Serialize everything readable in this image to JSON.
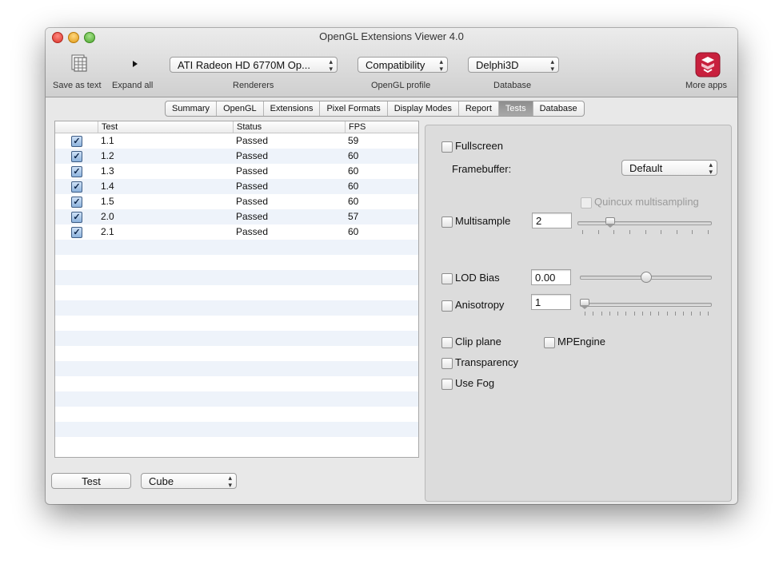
{
  "window": {
    "title": "OpenGL Extensions Viewer 4.0"
  },
  "toolbar": {
    "save_as_text": "Save as text",
    "expand_all": "Expand all",
    "renderer_value": "ATI Radeon HD 6770M Op...",
    "renderers_label": "Renderers",
    "profile_value": "Compatibility",
    "profile_label": "OpenGL profile",
    "database_value": "Delphi3D",
    "database_label": "Database",
    "more_apps": "More apps"
  },
  "tabs": [
    {
      "label": "Summary",
      "active": false
    },
    {
      "label": "OpenGL",
      "active": false
    },
    {
      "label": "Extensions",
      "active": false
    },
    {
      "label": "Pixel Formats",
      "active": false
    },
    {
      "label": "Display Modes",
      "active": false
    },
    {
      "label": "Report",
      "active": false
    },
    {
      "label": "Tests",
      "active": true
    },
    {
      "label": "Database",
      "active": false
    }
  ],
  "table": {
    "columns": [
      "Test",
      "Status",
      "FPS"
    ],
    "rows": [
      {
        "checked": true,
        "test": "1.1",
        "status": "Passed",
        "fps": "59"
      },
      {
        "checked": true,
        "test": "1.2",
        "status": "Passed",
        "fps": "60"
      },
      {
        "checked": true,
        "test": "1.3",
        "status": "Passed",
        "fps": "60"
      },
      {
        "checked": true,
        "test": "1.4",
        "status": "Passed",
        "fps": "60"
      },
      {
        "checked": true,
        "test": "1.5",
        "status": "Passed",
        "fps": "60"
      },
      {
        "checked": true,
        "test": "2.0",
        "status": "Passed",
        "fps": "57"
      },
      {
        "checked": true,
        "test": "2.1",
        "status": "Passed",
        "fps": "60"
      }
    ]
  },
  "bottom": {
    "test_button": "Test",
    "shape_value": "Cube"
  },
  "options": {
    "fullscreen": "Fullscreen",
    "framebuffer_label": "Framebuffer:",
    "framebuffer_value": "Default",
    "quincux": "Quincux multisampling",
    "multisample": "Multisample",
    "multisample_value": "2",
    "multisample_level": 0.125,
    "lod_bias": "LOD Bias",
    "lod_bias_value": "0.00",
    "lod_bias_level": 0.5,
    "anisotropy": "Anisotropy",
    "anisotropy_value": "1",
    "anisotropy_level": 0.0,
    "clip_plane": "Clip plane",
    "mpengine": "MPEngine",
    "transparency": "Transparency",
    "use_fog": "Use Fog"
  },
  "colors": {
    "active_tab": "#9a9a9a",
    "row_alt": "#eef3fa",
    "app_icon": "#c8203d"
  }
}
